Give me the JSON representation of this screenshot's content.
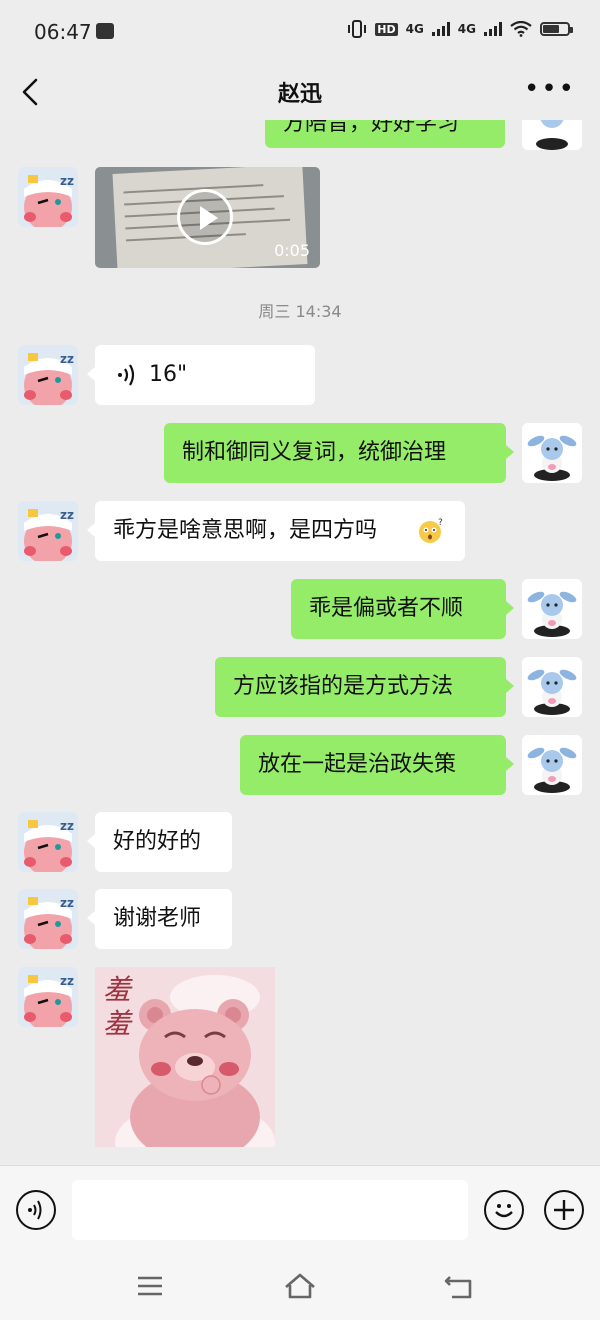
{
  "status": {
    "time": "06:47",
    "hd": "HD",
    "net1": "4G",
    "net2": "4G"
  },
  "header": {
    "title": "赵迅"
  },
  "messages": {
    "top_partial": "方陪音，好好学习",
    "video_duration": "0:05",
    "timestamp": "周三 14:34",
    "voice_duration": "16\"",
    "m1": "制和御同义复词，统御治理",
    "m2": "乖方是啥意思啊，是四方吗",
    "m3": "乖是偏或者不顺",
    "m4": "方应该指的是方式方法",
    "m5": "放在一起是治政失策",
    "m6": "好的好的",
    "m7": "谢谢老师"
  },
  "sticker": {
    "text": "羞羞"
  },
  "colors": {
    "outgoing_bubble": "#95ec69",
    "incoming_bubble": "#ffffff",
    "background": "#ececec"
  }
}
